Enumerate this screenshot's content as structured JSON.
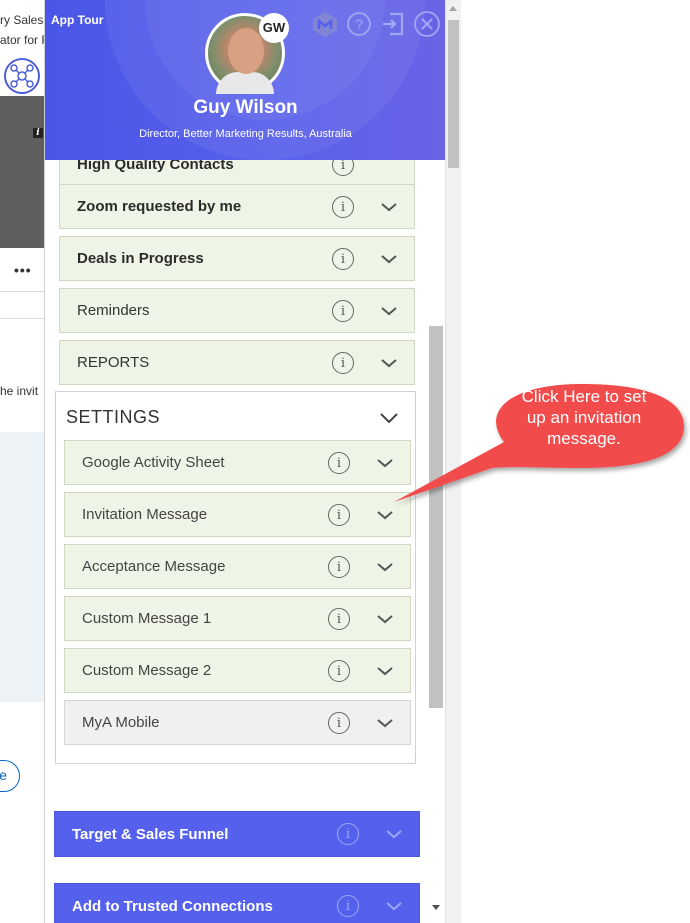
{
  "background_page": {
    "text_line_1": "ry Sales",
    "text_line_2": "ator for F",
    "text_line_3": "he invit",
    "dots": "•••",
    "pill_label": "e"
  },
  "header": {
    "app_tour_label": "App Tour",
    "initials": "GW",
    "user_name": "Guy Wilson",
    "user_title": "Director, Better Marketing Results, Australia",
    "icons": [
      "logo-icon",
      "help-icon",
      "exit-icon",
      "close-icon"
    ]
  },
  "list": {
    "partial_label": "High Quality Contacts",
    "items": [
      {
        "label": "Zoom requested by me",
        "bold": true
      },
      {
        "label": "Deals in Progress",
        "bold": true
      },
      {
        "label": "Reminders",
        "bold": false
      },
      {
        "label": "REPORTS",
        "bold": false
      }
    ],
    "settings": {
      "title": "SETTINGS",
      "items": [
        {
          "label": "Google Activity Sheet"
        },
        {
          "label": "Invitation Message"
        },
        {
          "label": "Acceptance Message"
        },
        {
          "label": "Custom Message 1"
        },
        {
          "label": "Custom Message 2"
        },
        {
          "label": "MyA Mobile"
        }
      ]
    },
    "blue_items": [
      {
        "label": "Target & Sales Funnel"
      },
      {
        "label": "Add to Trusted Connections"
      }
    ]
  },
  "callout": {
    "line1": "Click Here to set",
    "line2": "up an invitation",
    "line3": "message.",
    "color": "#f24b4b"
  },
  "colors": {
    "header_accent": "#5561ec",
    "row_bg": "#eff5e6",
    "callout": "#f24b4b"
  }
}
